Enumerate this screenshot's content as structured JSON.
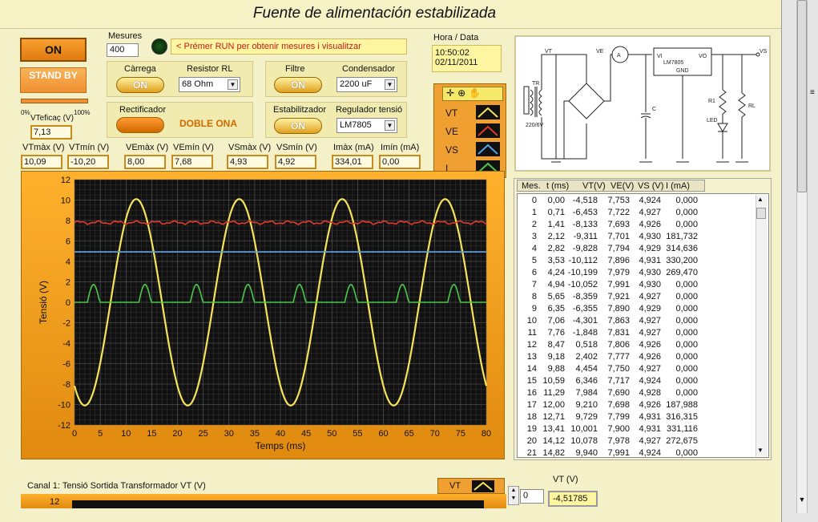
{
  "window": {
    "title": "Fuente de alimentación estabilizada"
  },
  "controls": {
    "on_label": "ON",
    "standby_label": "STAND BY",
    "mesures_label": "Mesures",
    "mesures_value": "400",
    "run_hint": "< Prémer RUN per obtenir mesures i visualitzar",
    "carrega_label": "Càrrega",
    "carrega_state": "ON",
    "resistor_label": "Resistor RL",
    "resistor_value": "68 Ohm",
    "filtre_label": "Filtre",
    "filtre_state": "ON",
    "condensador_label": "Condensador",
    "condensador_value": "2200 uF",
    "rectificador_label": "Rectificador",
    "rectificador_value": "DOBLE ONA",
    "estabilitzador_label": "Estabilitzador",
    "estabilitzador_state": "ON",
    "regulador_label": "Regulador tensió",
    "regulador_value": "LM7805",
    "vtef_label": "VTeficaç (V)",
    "vtef_value": "7,13",
    "scale_min": "0%",
    "scale_max": "100%"
  },
  "datetime": {
    "label": "Hora / Data",
    "time": "10:50:02",
    "date": "02/11/2011"
  },
  "readings": [
    {
      "label": "VTmàx (V)",
      "value": "10,09"
    },
    {
      "label": "VTmín (V)",
      "value": "-10,20"
    },
    {
      "label": "VEmàx (V)",
      "value": "8,00"
    },
    {
      "label": "VEmín (V)",
      "value": "7,68"
    },
    {
      "label": "VSmàx (V)",
      "value": "4,93"
    },
    {
      "label": "VSmín (V)",
      "value": "4,92"
    },
    {
      "label": "Imàx (mA)",
      "value": "334,01"
    },
    {
      "label": "Imín (mA)",
      "value": "0,00"
    }
  ],
  "legend": {
    "items": [
      {
        "name": "VT",
        "color": "#f5e45a"
      },
      {
        "name": "VE",
        "color": "#e53a2a"
      },
      {
        "name": "VS",
        "color": "#5aa0e8"
      },
      {
        "name": "I",
        "color": "#4cc84c"
      }
    ]
  },
  "schematic": {
    "labels": [
      "VT",
      "VE",
      "A",
      "VI",
      "LM7805",
      "VO",
      "GND",
      "VS",
      "TR",
      "220/6V",
      "C",
      "R1",
      "RL",
      "LED"
    ]
  },
  "chart_data": {
    "type": "line",
    "xlabel": "Temps (ms)",
    "ylabel": "Tensió (V)",
    "xlim": [
      0,
      80
    ],
    "ylim": [
      -12,
      12
    ],
    "xticks": [
      "0",
      "5",
      "10",
      "15",
      "20",
      "25",
      "30",
      "35",
      "40",
      "45",
      "50",
      "55",
      "60",
      "65",
      "70",
      "75",
      "80"
    ],
    "yticks": [
      "12",
      "10",
      "8",
      "6",
      "4",
      "2",
      "0",
      "-2",
      "-4",
      "-6",
      "-8",
      "-10",
      "-12"
    ],
    "grid": true,
    "series": [
      {
        "name": "VT",
        "color": "#f5e45a",
        "description_points": {
          "x": [
            0,
            2.5,
            5,
            7.5,
            10,
            12.5,
            15,
            17.5,
            20,
            22.5,
            25,
            27.5,
            30,
            32.5,
            35,
            37.5,
            40,
            42.5,
            45,
            47.5,
            50,
            52.5,
            55,
            57.5,
            60,
            62.5,
            65,
            67.5,
            70,
            72.5,
            75,
            77.5,
            80
          ],
          "y": [
            -4.5,
            -9.5,
            -10.1,
            -6.5,
            0,
            7,
            10,
            7,
            0,
            -7,
            -10,
            -7,
            0,
            7,
            10,
            7,
            0,
            -7,
            -10,
            -7,
            0,
            7,
            10,
            7,
            0,
            -7,
            -10,
            -7,
            0,
            7,
            10,
            7,
            -7.5
          ]
        }
      },
      {
        "name": "VE",
        "color": "#e53a2a",
        "description_points": {
          "x": [
            0,
            10,
            20,
            30,
            40,
            50,
            60,
            70,
            80
          ],
          "y": [
            7.8,
            7.8,
            7.9,
            7.8,
            7.9,
            7.8,
            7.9,
            7.8,
            7.8
          ]
        }
      },
      {
        "name": "VS",
        "color": "#5aa0e8",
        "description_points": {
          "x": [
            0,
            80
          ],
          "y": [
            4.93,
            4.93
          ]
        }
      },
      {
        "name": "I",
        "color": "#4cc84c",
        "description_points": {
          "x": [
            0,
            2,
            3,
            4,
            5,
            7,
            12,
            13,
            14,
            15,
            17,
            22,
            23,
            24,
            25,
            27,
            32,
            33,
            34,
            35,
            37,
            42,
            43,
            44,
            45,
            47,
            52,
            53,
            54,
            55,
            57,
            62,
            63,
            64,
            65,
            67,
            72,
            73,
            74,
            75,
            77,
            80
          ],
          "y": [
            0,
            0,
            1.7,
            1.7,
            0,
            0,
            0,
            1.7,
            1.7,
            0,
            0,
            0,
            1.7,
            1.7,
            0,
            0,
            0,
            1.7,
            1.7,
            0,
            0,
            0,
            1.7,
            1.7,
            0,
            0,
            0,
            1.7,
            1.7,
            0,
            0,
            0,
            1.7,
            1.7,
            0,
            0,
            0,
            1.7,
            1.7,
            0,
            0,
            0
          ]
        }
      }
    ]
  },
  "table": {
    "headers": [
      "Mes.",
      "t (ms)",
      "VT(V)",
      "VE(V)",
      "VS (V)",
      "I (mA)"
    ],
    "rows": [
      [
        "0",
        "0,00",
        "-4,518",
        "7,753",
        "4,924",
        "0,000"
      ],
      [
        "1",
        "0,71",
        "-6,453",
        "7,722",
        "4,927",
        "0,000"
      ],
      [
        "2",
        "1,41",
        "-8,133",
        "7,693",
        "4,926",
        "0,000"
      ],
      [
        "3",
        "2,12",
        "-9,311",
        "7,701",
        "4,930",
        "181,732"
      ],
      [
        "4",
        "2,82",
        "-9,828",
        "7,794",
        "4,929",
        "314,636"
      ],
      [
        "5",
        "3,53",
        "-10,112",
        "7,896",
        "4,931",
        "330,200"
      ],
      [
        "6",
        "4,24",
        "-10,199",
        "7,979",
        "4,930",
        "269,470"
      ],
      [
        "7",
        "4,94",
        "-10,052",
        "7,991",
        "4,930",
        "0,000"
      ],
      [
        "8",
        "5,65",
        "-8,359",
        "7,921",
        "4,927",
        "0,000"
      ],
      [
        "9",
        "6,35",
        "-6,355",
        "7,890",
        "4,929",
        "0,000"
      ],
      [
        "10",
        "7,06",
        "-4,301",
        "7,863",
        "4,927",
        "0,000"
      ],
      [
        "11",
        "7,76",
        "-1,848",
        "7,831",
        "4,927",
        "0,000"
      ],
      [
        "12",
        "8,47",
        "0,518",
        "7,806",
        "4,926",
        "0,000"
      ],
      [
        "13",
        "9,18",
        "2,402",
        "7,777",
        "4,926",
        "0,000"
      ],
      [
        "14",
        "9,88",
        "4,454",
        "7,750",
        "4,927",
        "0,000"
      ],
      [
        "15",
        "10,59",
        "6,346",
        "7,717",
        "4,924",
        "0,000"
      ],
      [
        "16",
        "11,29",
        "7,984",
        "7,690",
        "4,928",
        "0,000"
      ],
      [
        "17",
        "12,00",
        "9,210",
        "7,698",
        "4,926",
        "187,988"
      ],
      [
        "18",
        "12,71",
        "9,729",
        "7,799",
        "4,931",
        "316,315"
      ],
      [
        "19",
        "13,41",
        "10,001",
        "7,900",
        "4,931",
        "331,116"
      ],
      [
        "20",
        "14,12",
        "10,078",
        "7,978",
        "4,927",
        "272,675"
      ],
      [
        "21",
        "14,82",
        "9,940",
        "7,991",
        "4,924",
        "0,000"
      ]
    ]
  },
  "bottom": {
    "channel_label": "Canal 1:  Tensió Sortida Transformador VT (V)",
    "legend_name": "VT",
    "ytick": "12",
    "index_value": "0",
    "vt_label": "VT (V)",
    "vt_value": "-4,51785"
  }
}
